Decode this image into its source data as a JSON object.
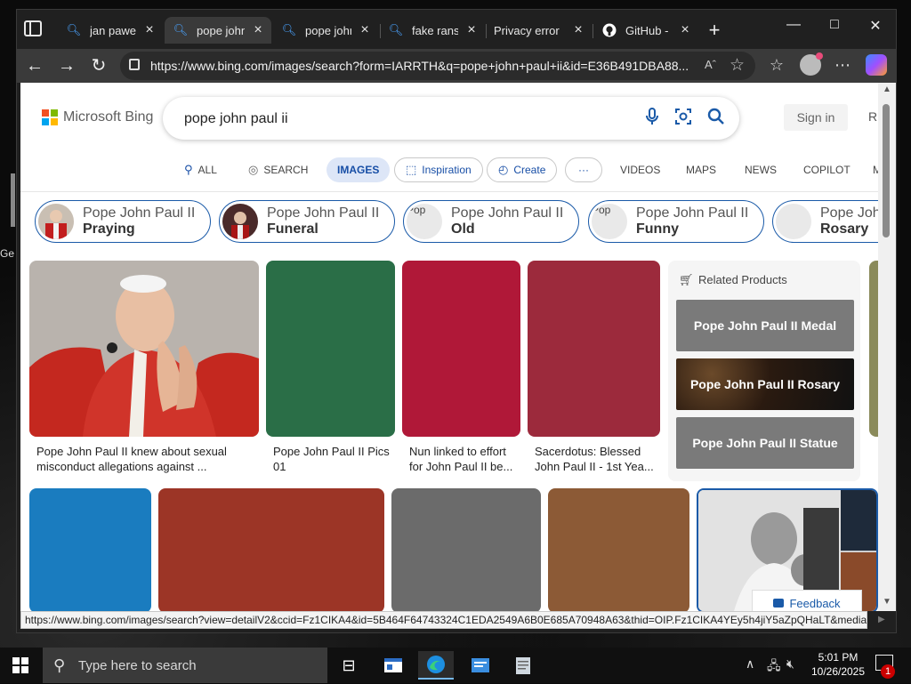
{
  "desktop": {
    "left_label": "Ge"
  },
  "tabs": [
    {
      "label": "jan pawel II",
      "active": false,
      "icon": "bing-search-icon"
    },
    {
      "label": "pope john p",
      "active": true,
      "icon": "bing-search-icon"
    },
    {
      "label": "pope john p",
      "active": false,
      "icon": "bing-search-icon"
    },
    {
      "label": "fake ransom",
      "active": false,
      "icon": "bing-search-icon"
    },
    {
      "label": "Privacy error",
      "active": false,
      "icon": "none"
    },
    {
      "label": "GitHub - us",
      "active": false,
      "icon": "github-icon"
    }
  ],
  "address": {
    "url": "https://www.bing.com/images/search?form=IARRTH&q=pope+john+paul+ii&id=E36B491DBA88..."
  },
  "bing": {
    "logo_text": "Microsoft Bing",
    "search_value": "pope john paul ii",
    "signin": "Sign in",
    "rewards_fragment": "R",
    "scopes": {
      "all": "ALL",
      "search": "SEARCH",
      "images": "IMAGES",
      "inspiration": "Inspiration",
      "create": "Create",
      "more": "···",
      "videos": "VIDEOS",
      "maps": "MAPS",
      "news": "NEWS",
      "copilot": "COPILOT",
      "more_fragment": "M"
    },
    "chips": [
      {
        "main": "Pope John Paul II",
        "sub": "Praying",
        "img_alt": ""
      },
      {
        "main": "Pope John Paul II",
        "sub": "Funeral",
        "img_alt": ""
      },
      {
        "main": "Pope John Paul II",
        "sub": "Old",
        "img_alt": "Pop"
      },
      {
        "main": "Pope John Paul II",
        "sub": "Funny",
        "img_alt": "Pop"
      },
      {
        "main": "Pope John",
        "sub": "Rosary",
        "img_alt": ""
      }
    ],
    "results_row1": [
      {
        "caption": "Pope John Paul II knew about sexual misconduct allegations against ...",
        "color": "#b8b2ac"
      },
      {
        "caption": "Pope John Paul II Pics 01",
        "color": "#2a6e47"
      },
      {
        "caption": "Nun linked to effort for John Paul II be...",
        "color": "#b01838"
      },
      {
        "caption": "Sacerdotus: Blessed John Paul II - 1st Yea...",
        "color": "#9c2a3c"
      }
    ],
    "results_row2": [
      {
        "color": "#1a7cbf"
      },
      {
        "color": "#9c3526"
      },
      {
        "color": "#6b6b6b"
      },
      {
        "color": "#8c5a36"
      }
    ],
    "related": {
      "title": "Related Products",
      "items": [
        {
          "label": "Pope John Paul II Medal"
        },
        {
          "label": "Pope John Paul II Rosary"
        },
        {
          "label": "Pope John Paul II Statue"
        }
      ]
    },
    "feedback": "Feedback"
  },
  "statusbar": {
    "url": "https://www.bing.com/images/search?view=detailV2&ccid=Fz1CIKA4&id=5B464F64743324C1EDA2549A6B0E685A70948A63&thid=OIP.Fz1CIKA4YEy5h4jiY5aZpQHaLT&media..."
  },
  "taskbar": {
    "search_placeholder": "Type here to search",
    "time": "5:01 PM",
    "date": "10/26/2025",
    "notification_count": "1"
  }
}
